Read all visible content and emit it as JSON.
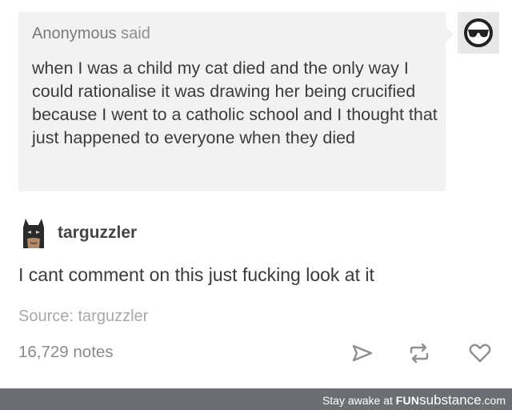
{
  "ask": {
    "asker_name": "Anonymous",
    "asker_suffix": " said",
    "question": "when I was a child my cat died and the only way I could rationalise it was drawing her being crucified because I went to a catholic school and I thought that just happened to everyone when they died"
  },
  "icons": {
    "anon_avatar": "sunglasses-face-icon",
    "responder_avatar": "batman-avatar-icon",
    "share": "paper-plane-icon",
    "reblog": "reblog-arrows-icon",
    "like": "heart-icon"
  },
  "response": {
    "username": "targuzzler",
    "text": "I cant comment on this just fucking look at it",
    "source": "Source: targuzzler"
  },
  "post": {
    "notes": "16,729 notes"
  },
  "footer": {
    "prefix": "Stay awake at ",
    "brand_a": "FUN",
    "brand_b": "substance",
    "brand_c": ".com"
  },
  "colors": {
    "ask_background": "#f2f2f2",
    "footer_background": "#6b6e73",
    "muted_text": "#8a8a8a"
  }
}
